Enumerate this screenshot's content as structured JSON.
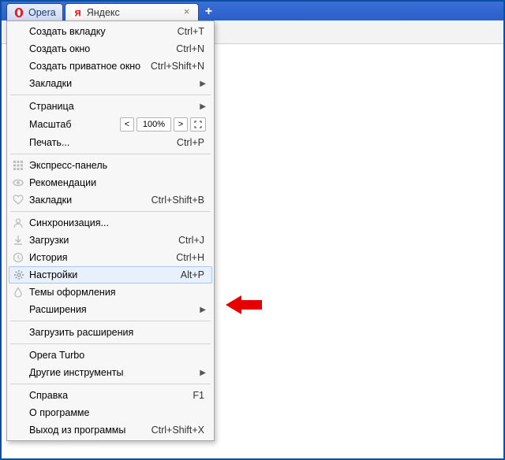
{
  "tabs": {
    "opera_label": "Opera",
    "site_label": "Яндекс",
    "close_glyph": "×",
    "plus_glyph": "+"
  },
  "menu": {
    "new_tab": {
      "label": "Создать вкладку",
      "shortcut": "Ctrl+T"
    },
    "new_window": {
      "label": "Создать окно",
      "shortcut": "Ctrl+N"
    },
    "new_private": {
      "label": "Создать приватное окно",
      "shortcut": "Ctrl+Shift+N"
    },
    "bookmarks_sub": {
      "label": "Закладки"
    },
    "page_sub": {
      "label": "Страница"
    },
    "zoom": {
      "label": "Масштаб",
      "value": "100%"
    },
    "print": {
      "label": "Печать...",
      "shortcut": "Ctrl+P"
    },
    "speed_dial": {
      "label": "Экспресс-панель"
    },
    "recommendations": {
      "label": "Рекомендации"
    },
    "bookmarks": {
      "label": "Закладки",
      "shortcut": "Ctrl+Shift+B"
    },
    "sync": {
      "label": "Синхронизация..."
    },
    "downloads": {
      "label": "Загрузки",
      "shortcut": "Ctrl+J"
    },
    "history": {
      "label": "История",
      "shortcut": "Ctrl+H"
    },
    "settings": {
      "label": "Настройки",
      "shortcut": "Alt+P"
    },
    "themes": {
      "label": "Темы оформления"
    },
    "extensions_sub": {
      "label": "Расширения"
    },
    "get_extensions": {
      "label": "Загрузить расширения"
    },
    "turbo": {
      "label": "Opera Turbo"
    },
    "other_tools": {
      "label": "Другие инструменты"
    },
    "help": {
      "label": "Справка",
      "shortcut": "F1"
    },
    "about": {
      "label": "О программе"
    },
    "exit": {
      "label": "Выход из программы",
      "shortcut": "Ctrl+Shift+X"
    }
  }
}
